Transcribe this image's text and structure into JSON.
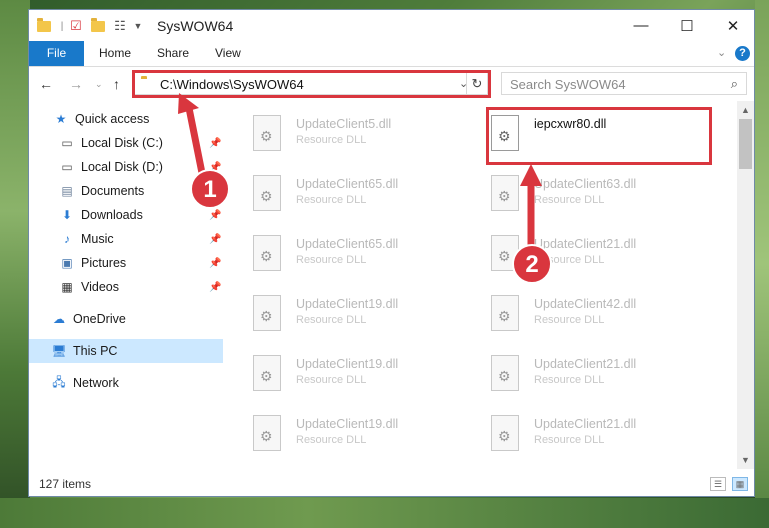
{
  "window": {
    "title": "SysWOW64",
    "controls": {
      "minimize": "—",
      "maximize": "☐",
      "close": "✕"
    }
  },
  "ribbon": {
    "tabs": [
      "File",
      "Home",
      "Share",
      "View"
    ],
    "expand_icon": "chevron-down-icon",
    "help_icon": "?"
  },
  "address": {
    "path": "C:\\Windows\\SysWOW64",
    "search_placeholder": "Search SysWOW64"
  },
  "nav": [
    {
      "label": "Quick access",
      "icon": "star-icon",
      "pinned": false
    },
    {
      "label": "Local Disk (C:)",
      "icon": "drive-icon",
      "pinned": true
    },
    {
      "label": "Local Disk (D:)",
      "icon": "drive-icon",
      "pinned": true
    },
    {
      "label": "Documents",
      "icon": "documents-icon",
      "pinned": true
    },
    {
      "label": "Downloads",
      "icon": "download-icon",
      "pinned": true
    },
    {
      "label": "Music",
      "icon": "music-icon",
      "pinned": true
    },
    {
      "label": "Pictures",
      "icon": "pictures-icon",
      "pinned": true
    },
    {
      "label": "Videos",
      "icon": "videos-icon",
      "pinned": true
    },
    {
      "label": "OneDrive",
      "icon": "cloud-icon",
      "pinned": false
    },
    {
      "label": "This PC",
      "icon": "computer-icon",
      "pinned": false,
      "selected": true
    },
    {
      "label": "Network",
      "icon": "network-icon",
      "pinned": false
    }
  ],
  "files": {
    "left": [
      {
        "name": "UpdateClient5.dll",
        "type": "Resource DLL"
      },
      {
        "name": "UpdateClient65.dll",
        "type": "Resource DLL"
      },
      {
        "name": "UpdateClient65.dll",
        "type": "Resource DLL"
      },
      {
        "name": "UpdateClient19.dll",
        "type": "Resource DLL"
      },
      {
        "name": "UpdateClient19.dll",
        "type": "Resource DLL"
      },
      {
        "name": "UpdateClient19.dll",
        "type": "Resource DLL"
      }
    ],
    "right": [
      {
        "name": "iepcxwr80.dll",
        "type": "",
        "active": true
      },
      {
        "name": "UpdateClient63.dll",
        "type": "Resource DLL"
      },
      {
        "name": "UpdateClient21.dll",
        "type": "Resource DLL"
      },
      {
        "name": "UpdateClient42.dll",
        "type": "Resource DLL"
      },
      {
        "name": "UpdateClient21.dll",
        "type": "Resource DLL"
      },
      {
        "name": "UpdateClient21.dll",
        "type": "Resource DLL"
      }
    ]
  },
  "status": {
    "item_count": "127 items"
  },
  "annotations": {
    "step1": "1",
    "step2": "2",
    "color": "#d9363e"
  }
}
